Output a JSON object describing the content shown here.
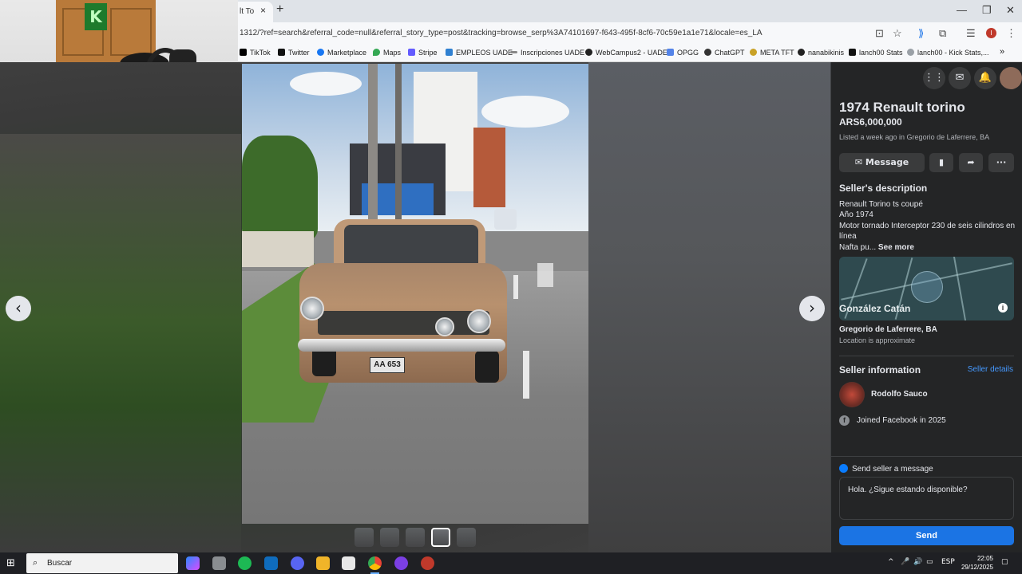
{
  "browser": {
    "tab_title": "lt To",
    "tab_close": "×",
    "new_tab": "+",
    "url": "1312/?ref=search&referral_code=null&referral_story_type=post&tracking=browse_serp%3A74101697-f643-495f-8cf6-70c59e1a1e71&locale=es_LA",
    "window_controls": [
      "—",
      "❐",
      "✕"
    ],
    "bookmarks": [
      {
        "label": "TikTok",
        "color": "#000000"
      },
      {
        "label": "Twitter",
        "color": "#111111"
      },
      {
        "label": "Marketplace",
        "color": "#1877f2"
      },
      {
        "label": "Maps",
        "color": "#34a853"
      },
      {
        "label": "Stripe",
        "color": "#635bff"
      },
      {
        "label": "EMPLEOS UADE",
        "color": "#2f80d1"
      },
      {
        "label": "Inscripciones UADE",
        "color": "#888888"
      },
      {
        "label": "WebCampus2 - UADE",
        "color": "#222222"
      },
      {
        "label": "OPGG",
        "color": "#5383e8"
      },
      {
        "label": "ChatGPT",
        "color": "#333333"
      },
      {
        "label": "META TFT",
        "color": "#c9a227"
      },
      {
        "label": "nanabikinis",
        "color": "#222222"
      },
      {
        "label": "lanch00 Stats",
        "color": "#111111"
      },
      {
        "label": "lanch00 - Kick Stats,...",
        "color": "#9aa0a6"
      }
    ],
    "bookmarks_more": "»",
    "profile_initial": "I"
  },
  "listing": {
    "title": "1974 Renault torino",
    "price": "ARS6,000,000",
    "listed": "Listed a week ago in Gregorio de Laferrere, BA",
    "message_button": "Message",
    "description_heading": "Seller's description",
    "description_lines": [
      "Renault Torino ts coupé",
      "Año 1974",
      "Motor tornado Interceptor 230 de seis cilindros en línea"
    ],
    "description_truncated": "Nafta pu...",
    "see_more": "See more",
    "map_label": "González Catán",
    "location_name": "Gregorio de Laferrere, BA",
    "location_note": "Location is approximate",
    "seller_info_heading": "Seller information",
    "seller_details_link": "Seller details",
    "seller_name": "Rodolfo Sauco",
    "joined": "Joined Facebook in 2025",
    "send_message_label": "Send seller a message",
    "message_text": "Hola. ¿Sigue estando disponible?",
    "send_button": "Send",
    "plate": "AA 653"
  },
  "viewer": {
    "prev": "‹",
    "next": "›",
    "thumbnail_count": 5,
    "active_thumbnail": 4
  },
  "taskbar": {
    "search_placeholder": "Buscar",
    "language": "ESP",
    "time": "22:05",
    "date": "29/12/2025"
  }
}
